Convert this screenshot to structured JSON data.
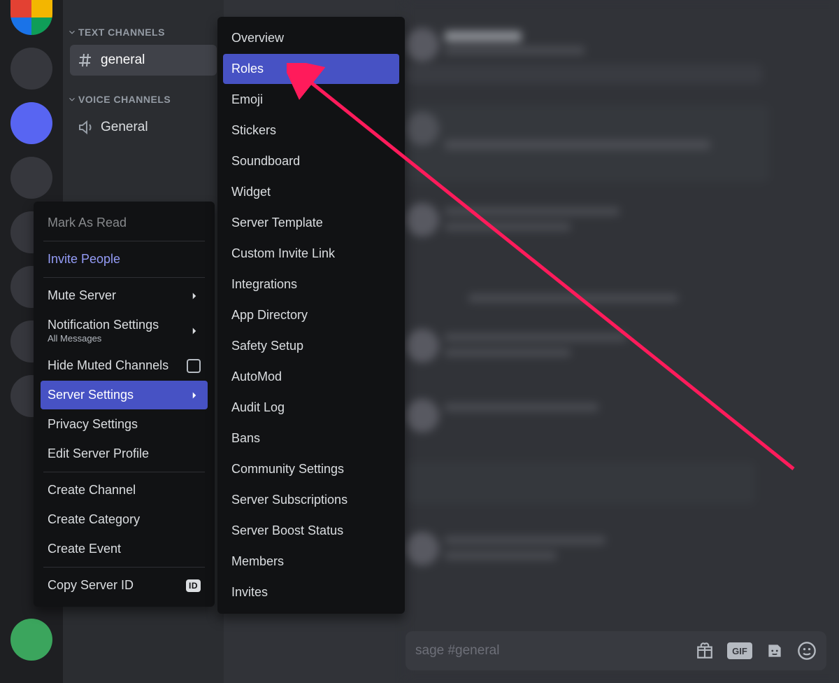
{
  "channel_sidebar": {
    "text_header": "TEXT CHANNELS",
    "voice_header": "VOICE CHANNELS",
    "text_channel": "general",
    "voice_channel": "General"
  },
  "context_menu": {
    "mark_read": "Mark As Read",
    "invite": "Invite People",
    "mute": "Mute Server",
    "notif": "Notification Settings",
    "notif_sub": "All Messages",
    "hide_muted": "Hide Muted Channels",
    "server_settings": "Server Settings",
    "privacy": "Privacy Settings",
    "edit_profile": "Edit Server Profile",
    "create_channel": "Create Channel",
    "create_category": "Create Category",
    "create_event": "Create Event",
    "copy_id": "Copy Server ID",
    "id_badge": "ID"
  },
  "submenu": {
    "items": [
      "Overview",
      "Roles",
      "Emoji",
      "Stickers",
      "Soundboard",
      "Widget",
      "Server Template",
      "Custom Invite Link",
      "Integrations",
      "App Directory",
      "Safety Setup",
      "AutoMod",
      "Audit Log",
      "Bans",
      "Community Settings",
      "Server Subscriptions",
      "Server Boost Status",
      "Members",
      "Invites"
    ],
    "selected_index": 1
  },
  "chat_input": {
    "placeholder_visible": "sage #general",
    "gif_label": "GIF"
  },
  "annotation": {
    "arrow_color": "#ff1b5b"
  }
}
